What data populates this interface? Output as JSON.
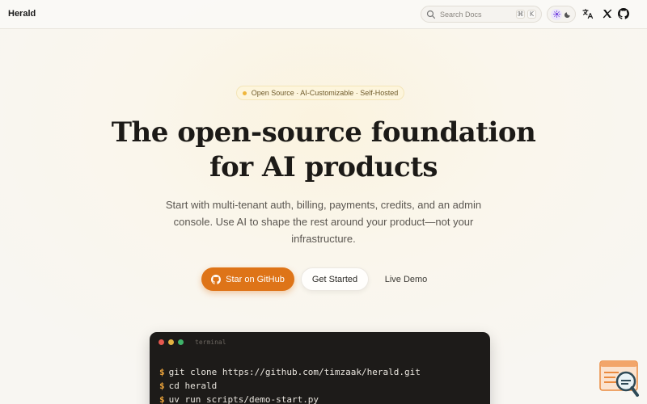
{
  "nav": {
    "brand": "Herald",
    "search_placeholder": "Search Docs",
    "search_shortcut": [
      "⌘",
      "K"
    ],
    "icons": [
      "search-icon",
      "sun-icon",
      "moon-icon",
      "translate-icon",
      "x-icon",
      "github-icon"
    ]
  },
  "hero": {
    "badge": "Open Source · AI-Customizable · Self-Hosted",
    "headline_line1": "The open-source foundation",
    "headline_line2": "for AI products",
    "subtitle": "Start with multi-tenant auth, billing, payments, credits, and an admin console. Use AI to shape the rest around your product—not your infrastructure."
  },
  "buttons": {
    "primary": "Star on GitHub",
    "secondary": "Get Started",
    "ghost": "Live Demo"
  },
  "terminal": {
    "label": "terminal",
    "prompt": "$",
    "lines": [
      "git clone https://github.com/timzaak/herald.git",
      "cd herald",
      "uv run scripts/demo-start.py"
    ]
  },
  "colors": {
    "accent": "#de7418",
    "badge_dot": "#efb63b",
    "terminal_bg": "#1d1b19",
    "prompt": "#e8a13a"
  }
}
